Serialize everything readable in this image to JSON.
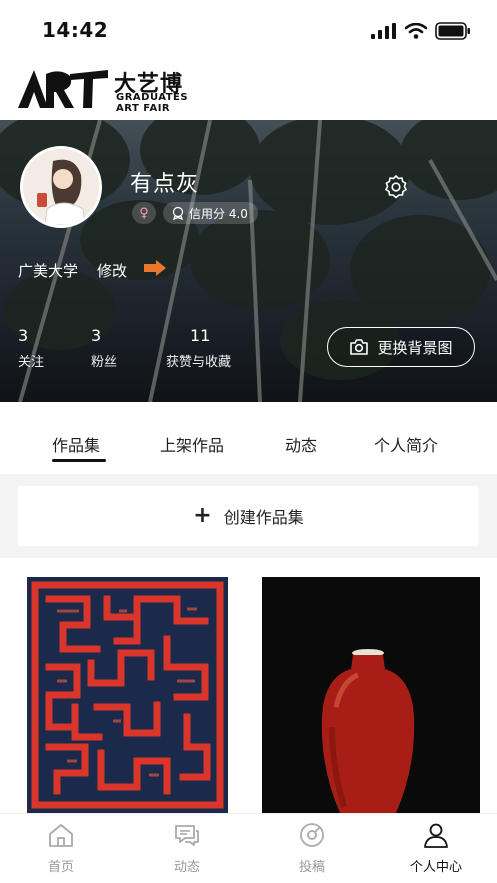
{
  "status": {
    "time": "14:42"
  },
  "brand": {
    "cn": "大艺博",
    "en_line1": "GRADUATES",
    "en_line2": "ART FAIR"
  },
  "profile": {
    "username": "有点灰",
    "gender_symbol": "♀",
    "credit": "信用分 4.0",
    "school": "广美大学",
    "edit_label": "修改"
  },
  "stats": [
    {
      "value": "3",
      "label": "关注"
    },
    {
      "value": "3",
      "label": "粉丝"
    },
    {
      "value": "11",
      "label": "获赞与收藏"
    }
  ],
  "change_background_label": "更换背景图",
  "tabs": [
    "作品集",
    "上架作品",
    "动态",
    "个人简介"
  ],
  "active_tab": "作品集",
  "create_collection_label": "创建作品集",
  "bottom_nav": [
    {
      "label": "首页",
      "icon": "home-icon"
    },
    {
      "label": "动态",
      "icon": "chat-icon"
    },
    {
      "label": "投稿",
      "icon": "submit-icon"
    },
    {
      "label": "个人中心",
      "icon": "person-icon"
    }
  ],
  "colors": {
    "accent_orange": "#e8762c",
    "text_dark": "#222222",
    "inactive_gray": "#999999"
  }
}
